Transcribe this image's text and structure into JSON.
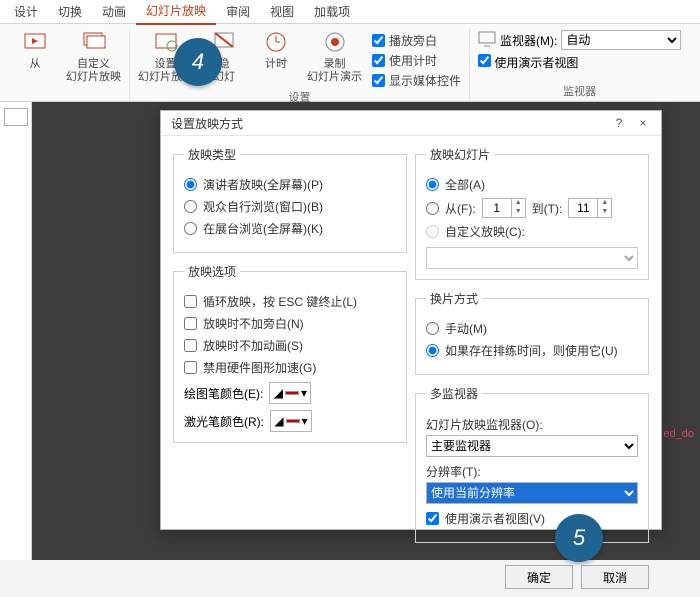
{
  "tabs": {
    "t0": "设计",
    "t1": "切换",
    "t2": "动画",
    "t3": "幻灯片放映",
    "t4": "审阅",
    "t5": "视图",
    "t6": "加载项"
  },
  "ribbon": {
    "btn_from": "从",
    "btn_custom": "自定义\n幻灯片放映",
    "btn_setup": "设置\n幻灯片放映",
    "btn_hide": "隐\n幻灯",
    "btn_rehearse": "计时",
    "btn_record": "录制\n幻灯片演示",
    "chk_narration": "播放旁白",
    "chk_timing": "使用计时",
    "chk_media": "显示媒体控件",
    "group_settings": "设置",
    "group_monitor": "监视器",
    "monitor_label": "监视器(M):",
    "monitor_value": "自动",
    "chk_presenter": "使用演示者视图"
  },
  "dialog": {
    "title": "设置放映方式",
    "help": "?",
    "close": "×",
    "g_type": "放映类型",
    "r_type1": "演讲者放映(全屏幕)(P)",
    "r_type2": "观众自行浏览(窗口)(B)",
    "r_type3": "在展台浏览(全屏幕)(K)",
    "g_opts": "放映选项",
    "c_loop": "循环放映，按 ESC 键终止(L)",
    "c_nonarr": "放映时不加旁白(N)",
    "c_noanim": "放映时不加动画(S)",
    "c_nohwacc": "禁用硬件图形加速(G)",
    "lbl_pen": "绘图笔颜色(E):",
    "lbl_laser": "激光笔颜色(R):",
    "g_slides": "放映幻灯片",
    "r_all": "全部(A)",
    "r_from": "从(F):",
    "to": "到(T):",
    "from_v": "1",
    "to_v": "11",
    "r_custom": "自定义放映(C):",
    "g_advance": "换片方式",
    "r_manual": "手动(M)",
    "r_timed": "如果存在排练时间，则使用它(U)",
    "g_multi": "多监视器",
    "lbl_slidemon": "幻灯片放映监视器(O):",
    "sel_mon": "主要监视器",
    "lbl_res": "分辨率(T):",
    "sel_res": "使用当前分辨率",
    "chk_usepresenter": "使用演示者视图(V)",
    "ok": "确定",
    "cancel": "取消"
  },
  "badges": {
    "b4": "4",
    "b5": "5"
  },
  "red": "ed_do"
}
